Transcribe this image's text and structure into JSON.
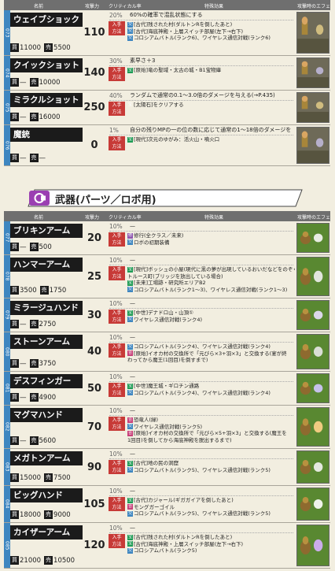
{
  "header": {
    "c_name": "名前",
    "c_atk": "攻撃力",
    "c_crit": "クリティカル率",
    "c_effect": "特殊効果",
    "c_anim": "攻撃時のエフェクト"
  },
  "how_label": "入手\n方法",
  "price_tags": {
    "buy": "買",
    "sell": "売"
  },
  "icons": {
    "sp": "宝",
    "tr": "交",
    "tc": "合",
    "sk": "ス",
    "pu": "修",
    "ch": "宝"
  },
  "ammo": [
    {
      "num": "073",
      "name": "ウェイブショック",
      "buy": "11000",
      "sell": "5500",
      "atk": "110",
      "crit": "20%",
      "effect": "60%の確率で混乱状態にする",
      "methods": [
        {
          "icon": "tr",
          "text": "[古代]残された村(ダルトンRを倒したあと)"
        },
        {
          "icon": "tr",
          "text": "[古代]海底神殿・上層スイッチ部屋(左下→右下)"
        },
        {
          "icon": "tr",
          "text": "コロシアムバトル(ランク6)、ワイヤレス通信対戦(ランク6)"
        }
      ]
    },
    {
      "num": "074",
      "name": "クイックショット",
      "buy": "—",
      "sell": "10000",
      "atk": "140",
      "crit": "30%",
      "effect": "素早さ＋3",
      "methods": [
        {
          "icon": "sp",
          "text": "[原始]竜の聖域・太古の城・B1宝物庫"
        }
      ]
    },
    {
      "num": "075",
      "name": "ミラクルショット",
      "buy": "—",
      "sell": "16000",
      "atk": "250",
      "crit": "40%",
      "effect": "ランダムで通常の0.1〜3.0倍のダメージを与える(→P.435)",
      "methods": [
        {
          "icon": "ch",
          "text": "[太陽石]をクリアする"
        }
      ]
    },
    {
      "num": "076",
      "name": "魔銃",
      "buy": "—",
      "sell": "—",
      "atk": "0",
      "crit": "1%",
      "effect": "自分の残りMPの一の位の数に応じて通常の1〜18倍のダメージを与える(→P.435)",
      "methods": [
        {
          "icon": "sp",
          "text": "[現代]次元のゆがみ：活火山・噴火口"
        }
      ]
    }
  ],
  "section_title": "武器(パーツ／ロボ用)",
  "parts": [
    {
      "num": "077",
      "name": "ブリキンアーム",
      "buy": "—",
      "sell": "500",
      "atk": "20",
      "crit": "10%",
      "effect": "—",
      "methods": [
        {
          "icon": "pu",
          "text": "修行(全クラス／未来)"
        },
        {
          "icon": "tr",
          "text": "ロボの初期装備"
        }
      ]
    },
    {
      "num": "078",
      "name": "ハンマーアーム",
      "buy": "3500",
      "sell": "1750",
      "atk": "25",
      "crit": "10%",
      "effect": "—",
      "methods": [
        {
          "icon": "sp",
          "text": "[現代]ボッシュの小屋(現代に黒の夢が出現しているおいだなどをのぞく)、"
        },
        {
          "icon": "",
          "text": "トルース町(ブリッジを放出している場合)"
        },
        {
          "icon": "sp",
          "text": "[未来]工場跡・研究所エリアB2"
        },
        {
          "icon": "tr",
          "text": "コロシアムバトル(ランク1〜3)、ワイヤレス通信対戦(ランク1〜3)"
        }
      ]
    },
    {
      "num": "079",
      "name": "ミラージュハンド",
      "buy": "—",
      "sell": "2750",
      "atk": "30",
      "crit": "10%",
      "effect": "—",
      "methods": [
        {
          "icon": "sp",
          "text": "[中世]デナドロ山・山頂①"
        },
        {
          "icon": "tr",
          "text": "ワイヤレス通信対戦(ランク4)"
        }
      ]
    },
    {
      "num": "080",
      "name": "ストーンアーム",
      "buy": "—",
      "sell": "3750",
      "atk": "40",
      "crit": "10%",
      "effect": "—",
      "methods": [
        {
          "icon": "tr",
          "text": "コロシアムバトル(ランク4)、ワイヤレス通信対戦(ランク4)"
        },
        {
          "icon": "tc",
          "text": "[原始]イオカ村の交換所で「元びら×3+羽×3」と交換する(宴が終"
        },
        {
          "icon": "",
          "text": "わってから魔王(1回目)を倒すまで)"
        }
      ]
    },
    {
      "num": "081",
      "name": "デスフィンガー",
      "buy": "—",
      "sell": "4900",
      "atk": "50",
      "crit": "10%",
      "effect": "—",
      "methods": [
        {
          "icon": "sp",
          "text": "[中世]魔王城・ギロチン通路"
        },
        {
          "icon": "tr",
          "text": "コロシアムバトル(ランク4)、ワイヤレス通信対戦(ランク4)"
        }
      ]
    },
    {
      "num": "082",
      "name": "マグマハンド",
      "buy": "—",
      "sell": "5600",
      "atk": "70",
      "crit": "10%",
      "effect": "—",
      "methods": [
        {
          "icon": "tc",
          "text": "恐竜人(緑)"
        },
        {
          "icon": "tr",
          "text": "ワイヤレス通信対戦(ランク5)"
        },
        {
          "icon": "tc",
          "text": "[原始]イオカ村の交換所で「元びら×5+羽×3」と交換する(魔王を"
        },
        {
          "icon": "",
          "text": "1回目)を倒してから海底神殿を脱出するまで)"
        }
      ]
    },
    {
      "num": "083",
      "name": "メガトンアーム",
      "buy": "15000",
      "sell": "7500",
      "atk": "90",
      "crit": "10%",
      "effect": "—",
      "methods": [
        {
          "icon": "sp",
          "text": "[古代]地の民の洞窟"
        },
        {
          "icon": "tr",
          "text": "コロシアムバトル(ランク5)、ワイヤレス通信対戦(ランク5)"
        }
      ]
    },
    {
      "num": "084",
      "name": "ビッグハンド",
      "buy": "18000",
      "sell": "9000",
      "atk": "105",
      "crit": "10%",
      "effect": "—",
      "methods": [
        {
          "icon": "sp",
          "text": "[古代]カジャール(ギガガイアを倒したあと)"
        },
        {
          "icon": "tc",
          "text": "モングガーゴイル"
        },
        {
          "icon": "tr",
          "text": "コロシアムバトル(ランク5)、ワイヤレス通信対戦(ランク5)"
        }
      ]
    },
    {
      "num": "085",
      "name": "カイザーアーム",
      "buy": "21000",
      "sell": "10500",
      "atk": "120",
      "crit": "10%",
      "effect": "—",
      "methods": [
        {
          "icon": "sp",
          "text": "[古代]残された村(ダルトンRを倒したあと)"
        },
        {
          "icon": "sp",
          "text": "[古代]海底神殿・上層スイッチ部屋(左下→右下)"
        },
        {
          "icon": "tr",
          "text": "コロシアムバトル(ランク5)"
        }
      ]
    }
  ]
}
